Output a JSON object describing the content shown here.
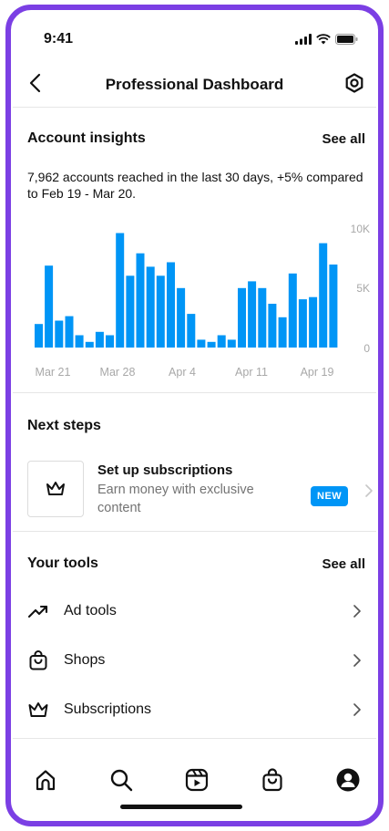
{
  "status_bar": {
    "time": "9:41"
  },
  "header": {
    "title": "Professional Dashboard"
  },
  "insights": {
    "title": "Account insights",
    "see_all": "See all",
    "summary": "7,962 accounts reached in the last 30 days, +5% compared to Feb 19 - Mar 20."
  },
  "chart_data": {
    "type": "bar",
    "y_tick_labels": [
      "10K",
      "5K",
      "0"
    ],
    "ylim": [
      0,
      10000
    ],
    "x_tick_labels": [
      "Mar 21",
      "Mar 28",
      "Apr 4",
      "Apr 11",
      "Apr 19"
    ],
    "values": [
      2100,
      7300,
      2400,
      2800,
      1100,
      500,
      1400,
      1100,
      10200,
      6400,
      8400,
      7200,
      6400,
      7600,
      5300,
      3000,
      700,
      500,
      1100,
      700,
      5300,
      5900,
      5300,
      3900,
      2700,
      6600,
      4300,
      4500,
      9300,
      7400
    ],
    "bar_color": "#0095f6"
  },
  "next_steps": {
    "title": "Next steps",
    "card_title": "Set up subscriptions",
    "card_desc": "Earn money with exclusive content",
    "badge": "NEW"
  },
  "tools": {
    "title": "Your tools",
    "see_all": "See all",
    "items": [
      {
        "label": "Ad tools",
        "icon": "trending-up-icon"
      },
      {
        "label": "Shops",
        "icon": "shopping-bag-icon"
      },
      {
        "label": "Subscriptions",
        "icon": "crown-icon"
      }
    ]
  },
  "tab_bar": {
    "tabs": [
      "home-icon",
      "search-icon",
      "reels-icon",
      "shop-icon",
      "profile-icon"
    ]
  }
}
